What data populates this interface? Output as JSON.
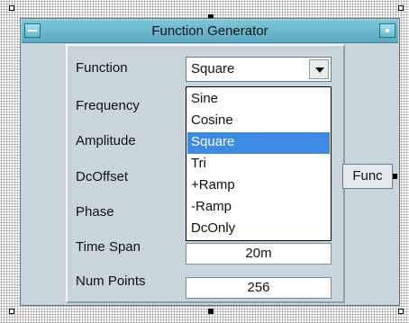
{
  "window": {
    "title": "Function Generator"
  },
  "form": {
    "function_label": "Function",
    "frequency_label": "Frequency",
    "amplitude_label": "Amplitude",
    "dcoffset_label": "DcOffset",
    "phase_label": "Phase",
    "timespan_label": "Time Span",
    "timespan_value": "20m",
    "numpoints_label": "Num Points",
    "numpoints_value": "256"
  },
  "function_select": {
    "selected": "Square",
    "options": [
      "Sine",
      "Cosine",
      "Square",
      "Tri",
      "+Ramp",
      "-Ramp",
      "DcOnly"
    ]
  },
  "output_pin": {
    "label": "Func"
  },
  "icons": [
    "minimize-icon",
    "restore-icon",
    "dropdown-arrow-icon"
  ]
}
